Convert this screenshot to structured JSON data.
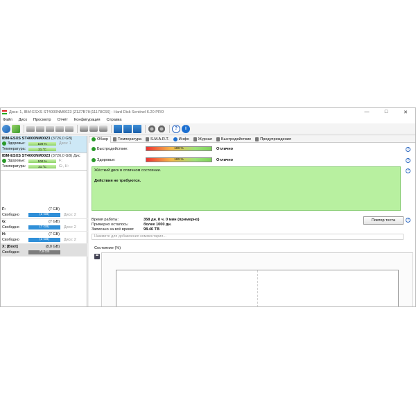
{
  "window": {
    "title": "Диск: 1, IBM-ESXS ST4000NM0023 [Z1Z7B7H(11178C66] - Hard Disk Sentinel 6.20 PRO",
    "controls": [
      "—",
      "□",
      "✕"
    ]
  },
  "menu": [
    "Файл",
    "Диск",
    "Просмотр",
    "Отчёт",
    "Конфигурация",
    "Справка"
  ],
  "toolbar_icons": [
    "refresh-icon",
    "refresh-all-icon",
    "drive-icon",
    "drive-icon",
    "drive-icon",
    "disk-test-icon",
    "disk-test-icon",
    "disk-test-icon",
    "disk-surface-icon",
    "disk-surface-icon",
    "disk-surface-icon",
    "report-icon",
    "mail-icon",
    "send-icon",
    "settings-icon",
    "gear-icon",
    "help-icon",
    "info-icon"
  ],
  "disks": [
    {
      "name": "IBM-ESXS ST4000NM0023",
      "capacity": "(3726,0 GB)",
      "health_label": "Здоровье:",
      "health_value": "100 %",
      "health_ext": "Диск: 1",
      "temp_label": "Температура:",
      "temp_value": "21 °C",
      "temp_ext": ""
    },
    {
      "name": "IBM-ESXS ST4000NM0023",
      "capacity": "(3726,0 GB) Дис",
      "health_label": "Здоровье:",
      "health_value": "100 %",
      "health_ext": "F;",
      "temp_label": "Температура:",
      "temp_value": "21 °C",
      "temp_ext": "G:, H:"
    }
  ],
  "partitions": [
    {
      "letter": "F:",
      "size": "(7 GB)",
      "free_label": "Свободно",
      "free_value": "(2 GB)",
      "disk": "Диск: 2",
      "grey": false,
      "highlight": false
    },
    {
      "letter": "G:",
      "size": "(7 GB)",
      "free_label": "Свободно",
      "free_value": "(7 GB)",
      "disk": "Диск: 2",
      "grey": false,
      "highlight": false
    },
    {
      "letter": "H:",
      "size": "(7 GB)",
      "free_label": "Свободно",
      "free_value": "(2 GB)",
      "disk": "Диск: 2",
      "grey": false,
      "highlight": false
    },
    {
      "letter": "X: [Boot]",
      "size": "(8,0 GB)",
      "free_label": "Свободно",
      "free_value": "7,9 GB",
      "disk": "",
      "grey": true,
      "highlight": true
    }
  ],
  "tabs": [
    "Обзор",
    "Температура",
    "S.M.A.R.T.",
    "Инфо",
    "Журнал",
    "Быстродействие",
    "Предупреждения"
  ],
  "overview": {
    "performance_label": "Быстродействие:",
    "performance_value": "100 %",
    "performance_result": "Отлично",
    "health_label": "Здоровье:",
    "health_value": "100 %",
    "health_result": "Отлично",
    "status_line1": "Жёсткий диск в отличном состоянии.",
    "status_line2": "Действия не требуются.",
    "uptime_label": "Время работы:",
    "uptime_value": "358 дн. 8 ч. 0 мин (примерно)",
    "remaining_label": "Примерно осталось:",
    "remaining_value": "более 1000 дн.",
    "written_label": "Записано за всё время:",
    "written_value": "98.46 TB",
    "test_button": "Повтор теста",
    "comment_placeholder": "Нажмите для добавления комментария...",
    "graph_label": "Состояние (%)"
  },
  "colors": {
    "accent": "#2f8fd8",
    "status_box": "#b8f0a0",
    "selected": "#cde8f6"
  }
}
